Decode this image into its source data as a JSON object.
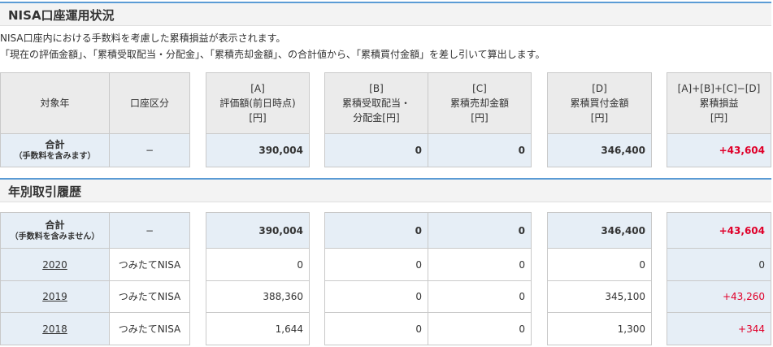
{
  "status_section": {
    "title": "NISA口座運用状況",
    "desc1": "NISA口座内における手数料を考慮した累積損益が表示されます。",
    "desc2": "「現在の評価金額」、「累積受取配当・分配金」、「累積売却金額」、の合計値から、「累積買付金額」を差し引いて算出します。"
  },
  "table_headers": {
    "year": "対象年",
    "account": "口座区分",
    "a": [
      "[A]",
      "評価額(前日時点)",
      "[円]"
    ],
    "b": [
      "[B]",
      "累積受取配当・",
      "分配金[円]"
    ],
    "c": [
      "[C]",
      "累積売却金額",
      "[円]"
    ],
    "d": [
      "[D]",
      "累積買付金額",
      "[円]"
    ],
    "total": [
      "[A]+[B]+[C]−[D]",
      "累積損益",
      "[円]"
    ]
  },
  "summary_total": {
    "label": "合計",
    "sublabel": "（手数料を含みます）",
    "account": "−",
    "a": "390,004",
    "b": "0",
    "c": "0",
    "d": "346,400",
    "profit": "+43,604"
  },
  "history_section": {
    "title": "年別取引履歴"
  },
  "history_total": {
    "label": "合計",
    "sublabel": "（手数料を含みません）",
    "account": "−",
    "a": "390,004",
    "b": "0",
    "c": "0",
    "d": "346,400",
    "profit": "+43,604"
  },
  "history_rows": [
    {
      "year": "2020",
      "account": "つみたてNISA",
      "a": "0",
      "b": "0",
      "c": "0",
      "d": "0",
      "profit": "0"
    },
    {
      "year": "2019",
      "account": "つみたてNISA",
      "a": "388,360",
      "b": "0",
      "c": "0",
      "d": "345,100",
      "profit": "+43,260"
    },
    {
      "year": "2018",
      "account": "つみたてNISA",
      "a": "1,644",
      "b": "0",
      "c": "0",
      "d": "1,300",
      "profit": "+344"
    }
  ],
  "colors": {
    "accent": "#5a9bd5",
    "profit_positive": "#e0002a",
    "header_bg": "#ebebeb",
    "total_bg": "#e6eef6"
  }
}
